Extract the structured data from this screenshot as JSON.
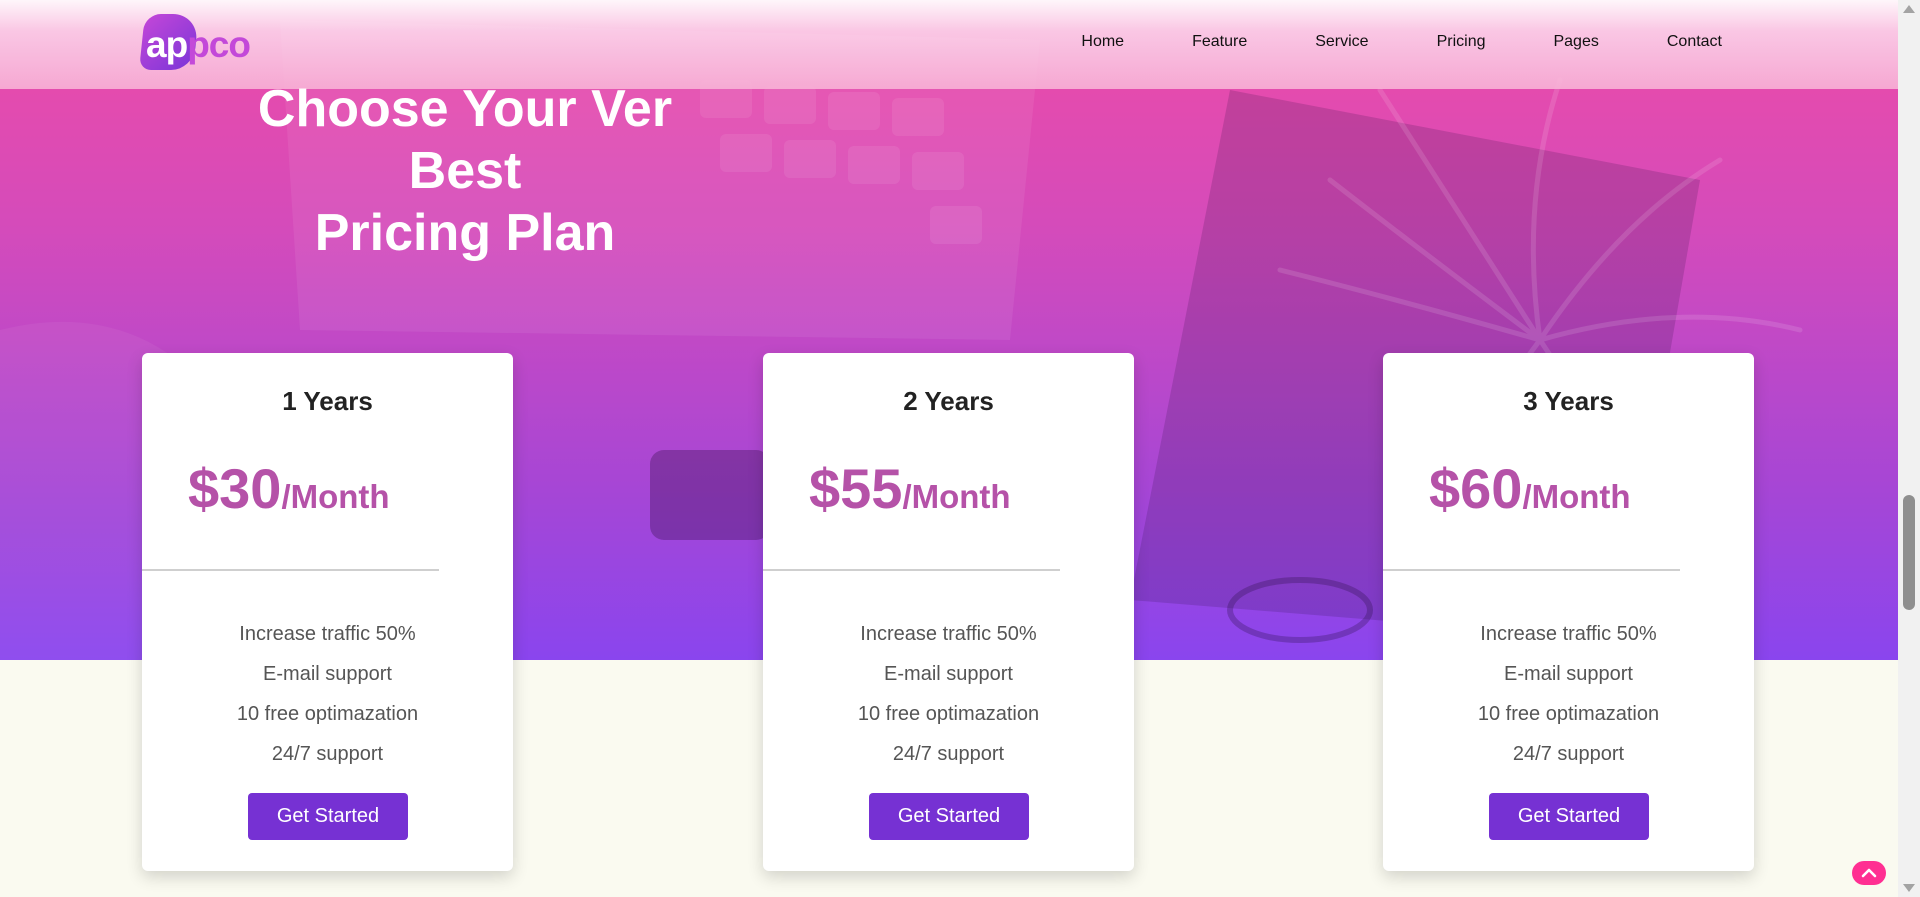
{
  "brand": {
    "logo_a": "ap",
    "logo_b": "pco"
  },
  "nav": {
    "items": [
      "Home",
      "Feature",
      "Service",
      "Pricing",
      "Pages",
      "Contact"
    ]
  },
  "hero": {
    "title_lines": [
      "Choose Your Ver",
      "Best",
      "Pricing Plan"
    ]
  },
  "plans": [
    {
      "duration": "1 Years",
      "price": "$30",
      "period": "/Month",
      "features": [
        "Increase traffic 50%",
        "E-mail support",
        "10 free optimazation",
        "24/7 support"
      ],
      "button": "Get Started"
    },
    {
      "duration": "2 Years",
      "price": "$55",
      "period": "/Month",
      "features": [
        "Increase traffic 50%",
        "E-mail support",
        "10 free optimazation",
        "24/7 support"
      ],
      "button": "Get Started"
    },
    {
      "duration": "3 Years",
      "price": "$60",
      "period": "/Month",
      "features": [
        "Increase traffic 50%",
        "E-mail support",
        "10 free optimazation",
        "24/7 support"
      ],
      "button": "Get Started"
    }
  ],
  "colors": {
    "accent": "#7631d3",
    "price": "#b552a8",
    "brand_pink": "#ff2f92",
    "hero_top": "#ee4ba6",
    "hero_bottom": "#8a45ee"
  },
  "icons": {
    "scroll_top": "chevron-up-icon"
  }
}
